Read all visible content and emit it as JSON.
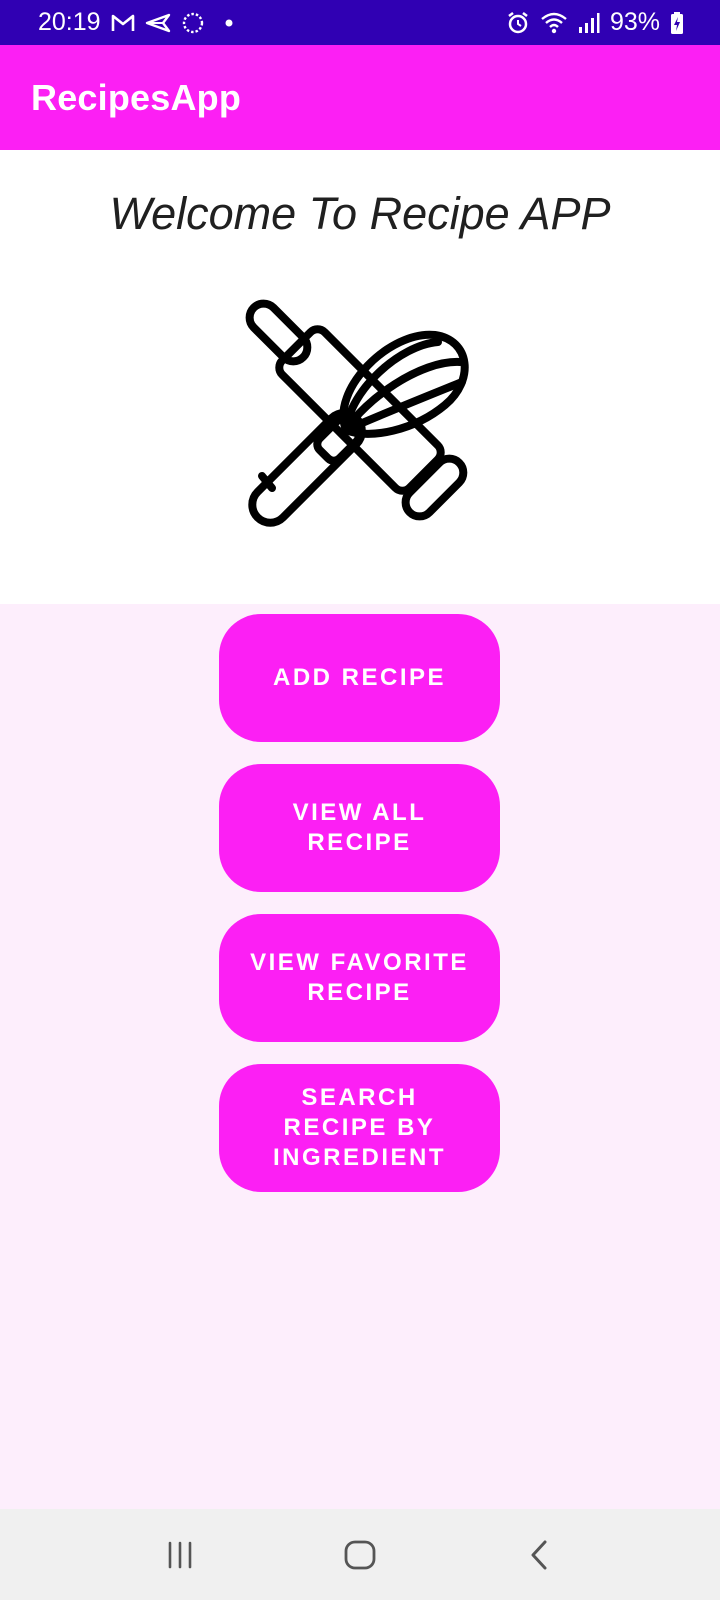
{
  "status_bar": {
    "time": "20:19",
    "left_icons": [
      "gmail-icon",
      "send-icon",
      "sync-icon",
      "dot-icon"
    ],
    "right_icons": [
      "alarm-icon",
      "wifi-icon",
      "signal-icon"
    ],
    "battery": "93%"
  },
  "app_bar": {
    "title": "RecipesApp"
  },
  "hero": {
    "welcome": "Welcome To Recipe APP",
    "illustration": "rolling-pin-and-whisk-icon"
  },
  "buttons": [
    {
      "label": "ADD RECIPE"
    },
    {
      "label": "VIEW ALL\nRECIPE"
    },
    {
      "label": "VIEW FAVORITE\nRECIPE"
    },
    {
      "label": "SEARCH\nRECIPE BY\nINGREDIENT"
    }
  ],
  "nav_bar": {
    "items": [
      "recents-icon",
      "home-icon",
      "back-icon"
    ]
  },
  "colors": {
    "status_bar": "#3000b3",
    "accent": "#fc1ff4",
    "background": "#fdeefc"
  }
}
